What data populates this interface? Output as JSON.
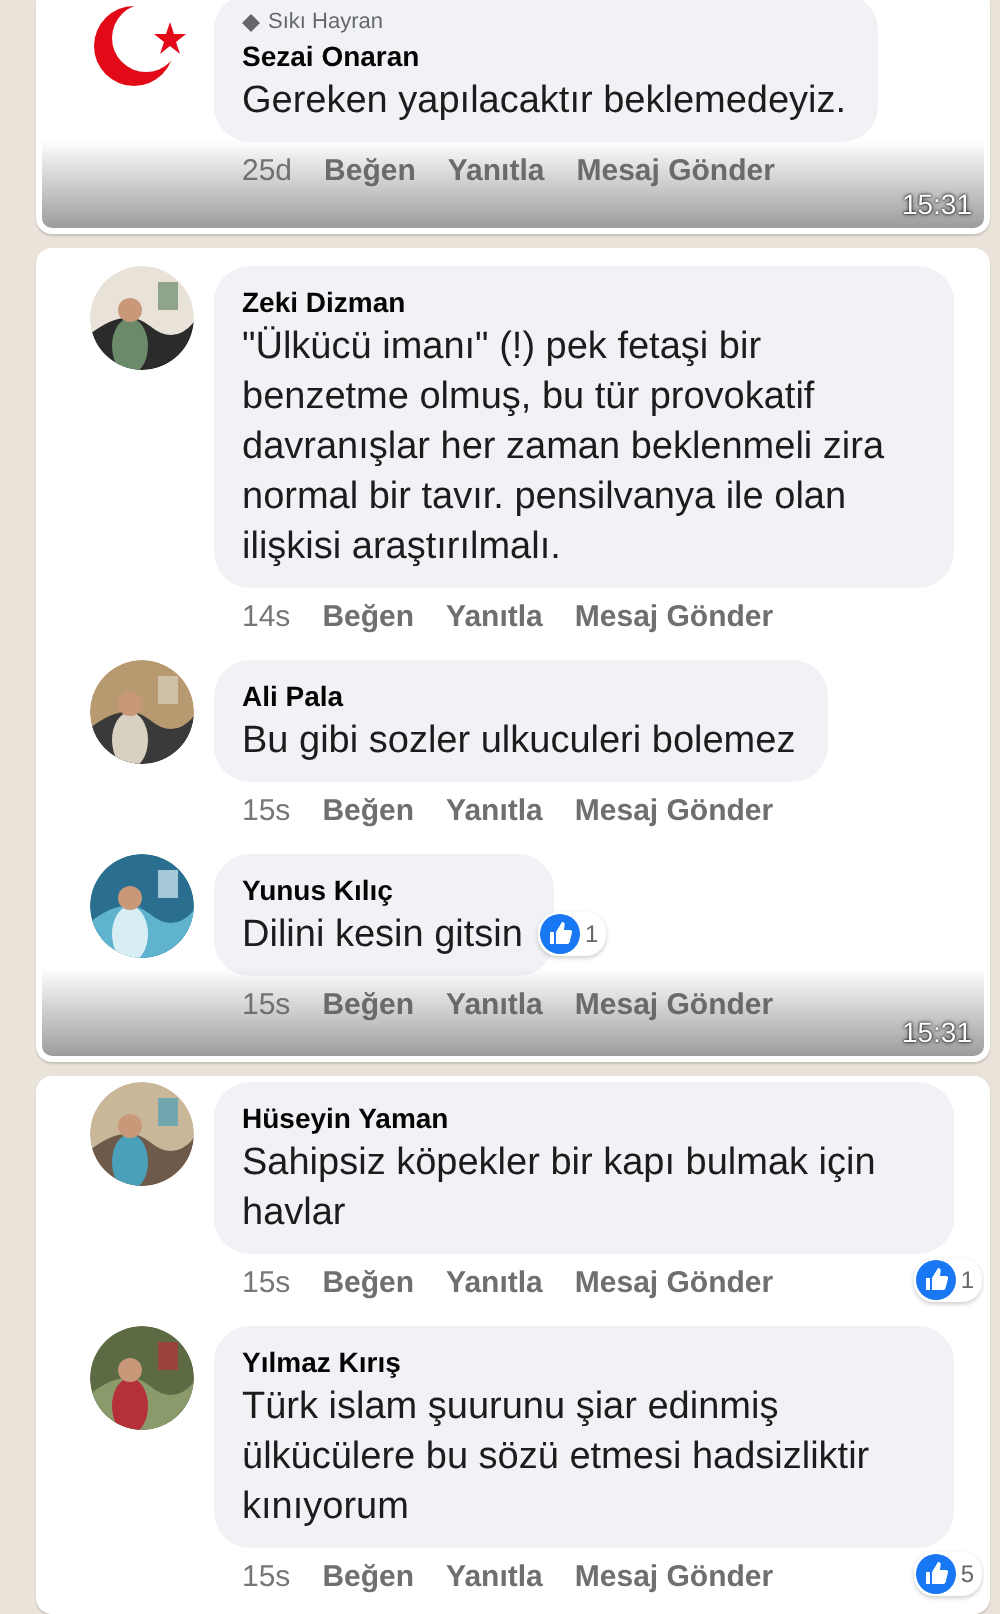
{
  "messages": [
    {
      "time": "15:31",
      "comments": [
        {
          "avatar": {
            "kind": "flag"
          },
          "badge": "Sıkı Hayran",
          "name": "Sezai Onaran",
          "text": "Gereken yapılacaktır beklemedeyiz.",
          "ago": "25d",
          "actions": [
            "Beğen",
            "Yanıtla",
            "Mesaj Gönder"
          ]
        }
      ]
    },
    {
      "time": "15:31",
      "comments": [
        {
          "name": "Zeki Dizman",
          "text": "\"Ülkücü imanı\" (!) pek fetaşi bir benzetme olmuş, bu tür provokatif davranışlar her zaman beklenmeli zira normal bir tavır. pensilvanya ile olan ilişkisi araştırılmalı.",
          "ago": "14s",
          "actions": [
            "Beğen",
            "Yanıtla",
            "Mesaj Gönder"
          ]
        },
        {
          "name": "Ali Pala",
          "text": "Bu gibi sozler ulkuculeri bolemez",
          "ago": "15s",
          "actions": [
            "Beğen",
            "Yanıtla",
            "Mesaj Gönder"
          ]
        },
        {
          "name": "Yunus Kılıç",
          "text": "Dilini kesin gitsin",
          "ago": "15s",
          "actions": [
            "Beğen",
            "Yanıtla",
            "Mesaj Gönder"
          ],
          "reaction": {
            "count": "1",
            "kind": "inline"
          }
        }
      ]
    },
    {
      "comments": [
        {
          "name": "Hüseyin Yaman",
          "text": "Sahipsiz köpekler bir kapı bulmak için havlar",
          "ago": "15s",
          "actions": [
            "Beğen",
            "Yanıtla",
            "Mesaj Gönder"
          ],
          "reaction": {
            "count": "1",
            "kind": "corner"
          }
        },
        {
          "name": "Yılmaz Kırış",
          "text": "Türk islam şuurunu şiar edinmiş ülkücülere bu sözü etmesi hadsizliktir kınıyorum",
          "ago": "15s",
          "actions": [
            "Beğen",
            "Yanıtla",
            "Mesaj Gönder"
          ],
          "reaction": {
            "count": "5",
            "kind": "corner"
          }
        }
      ]
    }
  ]
}
